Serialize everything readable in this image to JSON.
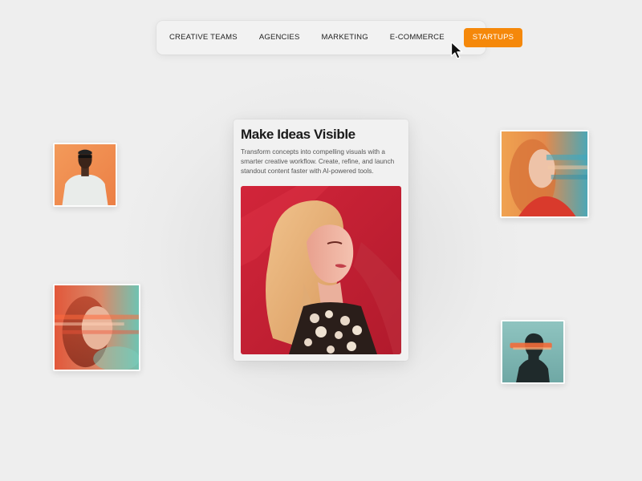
{
  "nav": {
    "items": [
      {
        "label": "CREATIVE TEAMS",
        "active": false
      },
      {
        "label": "AGENCIES",
        "active": false
      },
      {
        "label": "MARKETING",
        "active": false
      },
      {
        "label": "E-COMMERCE",
        "active": false
      },
      {
        "label": "STARTUPS",
        "active": true
      }
    ]
  },
  "card": {
    "title": "Make Ideas Visible",
    "description": "Transform concepts into compelling visuals with a smarter creative workflow. Create, refine, and launch standout content faster with AI-powered tools."
  },
  "colors": {
    "accent": "#f5880a",
    "background": "#ececec",
    "card_background": "#f1f1f1",
    "text_primary": "#1a1a1a",
    "text_secondary": "#555555"
  },
  "icons": {
    "cursor": "arrow-cursor-icon"
  }
}
